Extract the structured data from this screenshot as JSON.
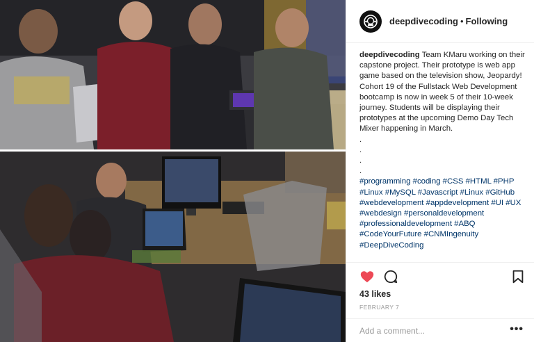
{
  "post": {
    "account": {
      "username": "deepdivecoding",
      "separator": "•",
      "follow_state": "Following"
    },
    "caption": {
      "username": "deepdivecoding",
      "text": "Team KMaru working on their capstone project. Their prototype is web app game based on the television show, Jeopardy! Cohort 19 of the Fullstack Web Development bootcamp is now in week 5 of their 10-week journey. Students will be displaying their prototypes at the upcoming Demo Day Tech Mixer happening in March.",
      "filler_lines": [
        ".",
        ".",
        ".",
        "."
      ],
      "hashtags": "#programming #coding #CSS #HTML #PHP #Linux #MySQL #Javascript #Linux #GitHub #webdevelopment #appdevelopment #UI #UX #webdesign #personaldevelopment #professionaldevelopment #ABQ #CodeYourFuture #CNMIngenuity #DeepDiveCoding"
    },
    "actions": {
      "like_icon": "heart-icon",
      "comment_icon": "comment-icon",
      "save_icon": "bookmark-icon",
      "liked_color": "#ed4956"
    },
    "likes": "43 likes",
    "date": "FEBRUARY 7",
    "comment": {
      "placeholder": "Add a comment...",
      "more_label": "•••"
    }
  }
}
